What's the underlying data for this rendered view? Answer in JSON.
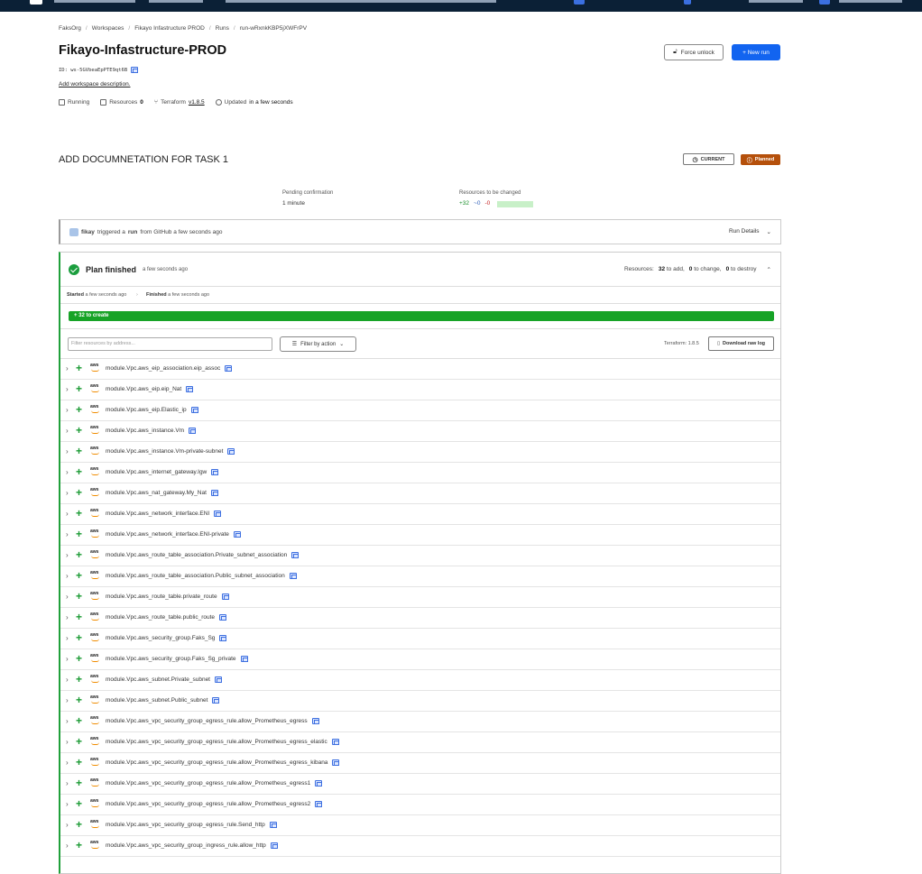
{
  "breadcrumb": [
    "FaksOrg",
    "Workspaces",
    "Fikayo Infastructure PROD",
    "Runs",
    "run-wRxnkKBP5jXWFrPV"
  ],
  "workspace": {
    "title": "Fikayo-Infastructure-PROD",
    "id": "ID: ws-5GVbeaEpPTE9qt6B",
    "description_link": "Add workspace description.",
    "status": "Running",
    "resources_label": "Resources",
    "resources_count": "0",
    "terraform_label": "Terraform",
    "terraform_version": "v1.8.5",
    "updated_label": "Updated",
    "updated_value": "in a few seconds"
  },
  "actions": {
    "force_unlock": "Force unlock",
    "new_run": "+ New run"
  },
  "run": {
    "title": "ADD DOCUMNETATION FOR TASK 1",
    "badge_current": "CURRENT",
    "badge_planned": "Planned",
    "pending_label": "Pending confirmation",
    "pending_value": "1 minute",
    "changed_label": "Resources to be changed",
    "changed_add": "+32",
    "changed_mod": "~0",
    "changed_del": "-0",
    "trigger_user": "fikay",
    "trigger_text_1": "triggered a",
    "trigger_run": "run",
    "trigger_text_2": "from GitHub a few seconds ago",
    "run_details": "Run Details"
  },
  "plan": {
    "title": "Plan finished",
    "when": "a few seconds ago",
    "res_prefix": "Resources:",
    "res_add": "32",
    "res_add_label": "to add,",
    "res_change": "0",
    "res_change_label": "to change,",
    "res_destroy": "0",
    "res_destroy_label": "to destroy",
    "started_label": "Started",
    "started_value": "a few seconds ago",
    "finished_label": "Finished",
    "finished_value": "a few seconds ago",
    "create_bar": "+  32 to create",
    "filter_placeholder": "Filter resources by address...",
    "filter_button": "Filter by action",
    "terraform_version": "Terraform: 1.8.5",
    "download": "Download raw log",
    "resources": [
      "module.Vpc.aws_eip_association.eip_assoc",
      "module.Vpc.aws_eip.eip_Nat",
      "module.Vpc.aws_eip.Elastic_ip",
      "module.Vpc.aws_instance.Vm",
      "module.Vpc.aws_instance.Vm-private-subnet",
      "module.Vpc.aws_internet_gateway.Igw",
      "module.Vpc.aws_nat_gateway.My_Nat",
      "module.Vpc.aws_network_interface.ENI",
      "module.Vpc.aws_network_interface.ENI-private",
      "module.Vpc.aws_route_table_association.Private_subnet_association",
      "module.Vpc.aws_route_table_association.Public_subnet_association",
      "module.Vpc.aws_route_table.private_route",
      "module.Vpc.aws_route_table.public_route",
      "module.Vpc.aws_security_group.Faks_Sg",
      "module.Vpc.aws_security_group.Faks_Sg_private",
      "module.Vpc.aws_subnet.Private_subnet",
      "module.Vpc.aws_subnet.Public_subnet",
      "module.Vpc.aws_vpc_security_group_egress_rule.allow_Prometheus_egress",
      "module.Vpc.aws_vpc_security_group_egress_rule.allow_Prometheus_egress_elastic",
      "module.Vpc.aws_vpc_security_group_egress_rule.allow_Prometheus_egress_kibana",
      "module.Vpc.aws_vpc_security_group_egress_rule.allow_Prometheus_egress1",
      "module.Vpc.aws_vpc_security_group_egress_rule.allow_Prometheus_egress2",
      "module.Vpc.aws_vpc_security_group_egress_rule.Send_http",
      "module.Vpc.aws_vpc_security_group_ingress_rule.allow_http"
    ],
    "provider_label": "aws"
  },
  "colors": {
    "primary": "#1264f0",
    "success": "#17a327",
    "planned": "#b5500b",
    "nav": "#0b2036"
  }
}
